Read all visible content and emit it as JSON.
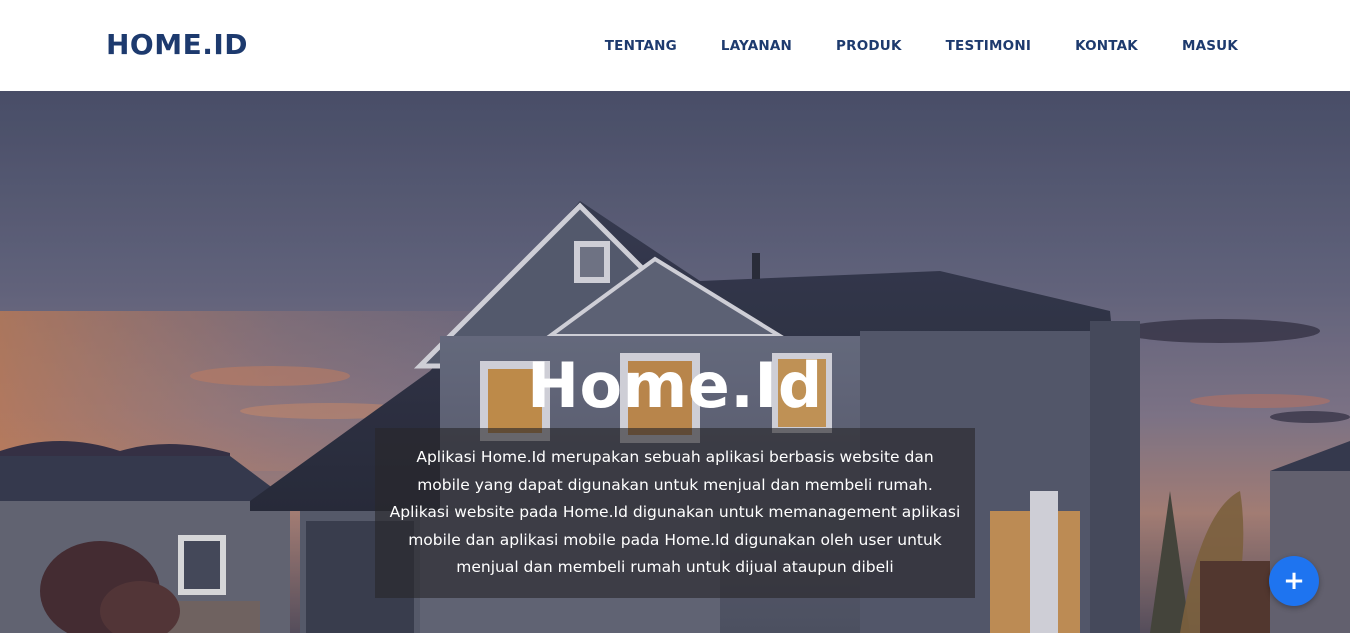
{
  "navbar": {
    "brand": "HOME.ID",
    "links": [
      "TENTANG",
      "LAYANAN",
      "PRODUK",
      "TESTIMONI",
      "KONTAK",
      "MASUK"
    ]
  },
  "hero": {
    "title": "Home.Id",
    "description": "Aplikasi Home.Id merupakan sebuah aplikasi berbasis website dan mobile yang dapat digunakan untuk menjual dan membeli rumah. Aplikasi website pada Home.Id digunakan untuk memanagement aplikasi mobile dan aplikasi mobile pada Home.Id digunakan oleh user untuk menjual dan membeli rumah untuk dijual ataupun dibeli",
    "background_image": "suburban-house-at-dusk"
  },
  "fab": {
    "icon": "plus-icon",
    "symbol": "+"
  },
  "colors": {
    "brand": "#1d3a6e",
    "fab": "#1e74f0"
  }
}
